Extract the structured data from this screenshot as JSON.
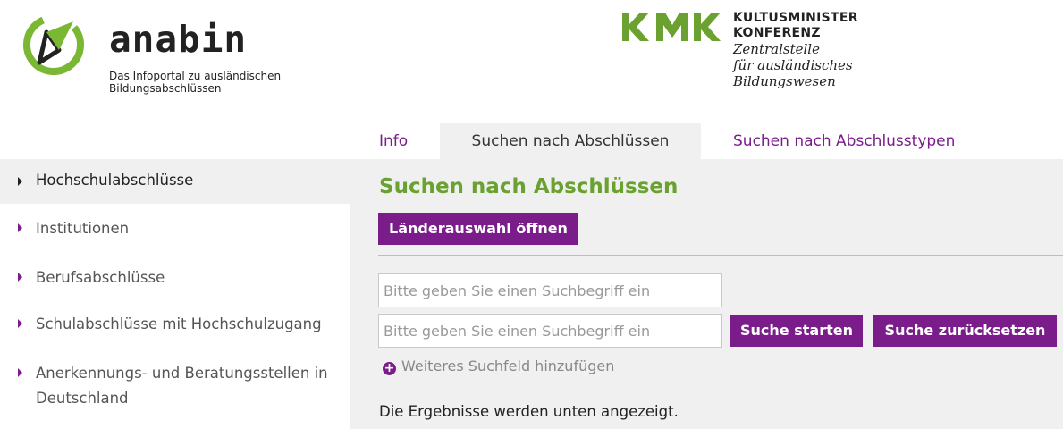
{
  "header": {
    "brand_name": "anabin",
    "brand_tagline_line1": "Das Infoportal zu ausländischen",
    "brand_tagline_line2": "Bildungsabschlüssen",
    "kmk_line1": "KULTUSMINISTER",
    "kmk_line2": "KONFERENZ",
    "kmk_line3": "Zentralstelle",
    "kmk_line4": "für ausländisches",
    "kmk_line5": "Bildungswesen",
    "brand_color": "#7ab833",
    "kmk_color": "#6aa130"
  },
  "tabs": [
    {
      "label": "Info",
      "active": false
    },
    {
      "label": "Suchen nach Abschlüssen",
      "active": true
    },
    {
      "label": "Suchen nach Abschlusstypen",
      "active": false
    }
  ],
  "sidebar": {
    "items": [
      {
        "label": "Hochschulabschlüsse",
        "active": true
      },
      {
        "label": "Institutionen",
        "active": false
      },
      {
        "label": "Berufsabschlüsse",
        "active": false
      },
      {
        "label": "Schulabschlüsse mit Hochschulzugang",
        "active": false
      },
      {
        "label_line1": "Anerkennungs- und Beratungsstellen in",
        "label_line2": "Deutschland",
        "active": false
      }
    ]
  },
  "main": {
    "title": "Suchen nach Abschlüssen",
    "countries_button": "Länderauswahl öffnen",
    "search_fields": [
      {
        "value": "",
        "placeholder": "Bitte geben Sie einen Suchbegriff ein"
      },
      {
        "value": "",
        "placeholder": "Bitte geben Sie einen Suchbegriff ein"
      }
    ],
    "start_button": "Suche starten",
    "reset_button": "Suche zurücksetzen",
    "add_field_label": "Weiteres Suchfeld hinzufügen",
    "results_note": "Die Ergebnisse werden unten angezeigt."
  },
  "colors": {
    "accent_purple": "#7a1d8b",
    "title_green": "#6aa130",
    "panel_gray": "#f0f0f0"
  },
  "icons": {
    "brand": "compass-logo-icon",
    "kmk": "kmk-logo-icon",
    "nav_arrow": "caret-right-icon",
    "add": "plus-circle-icon"
  }
}
